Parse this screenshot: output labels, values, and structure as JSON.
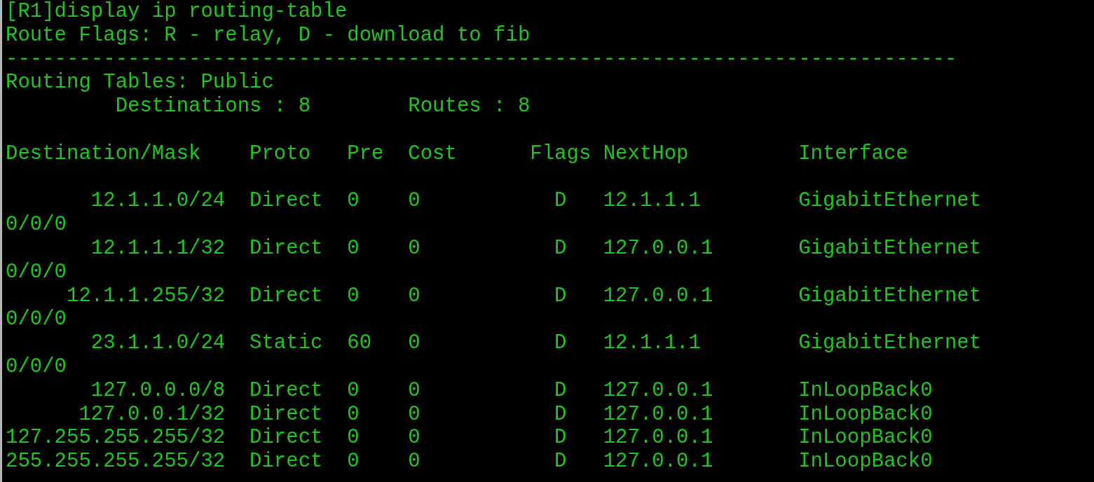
{
  "command": "[R1]display ip routing-table",
  "flags_legend": "Route Flags: R - relay, D - download to fib",
  "separator": "------------------------------------------------------------------------------",
  "table_title": "Routing Tables: Public",
  "summary": {
    "destinations": "Destinations : 8",
    "routes": "Routes : 8"
  },
  "columns": [
    "Destination/Mask",
    "Proto",
    "Pre",
    "Cost",
    "Flags",
    "NextHop",
    "Interface"
  ],
  "rows": [
    {
      "destination": "12.1.1.0/24",
      "proto": "Direct",
      "pre": "0",
      "cost": "0",
      "flags": "D",
      "nexthop": "12.1.1.1",
      "interface": "GigabitEthernet",
      "interface_continued": "0/0/0"
    },
    {
      "destination": "12.1.1.1/32",
      "proto": "Direct",
      "pre": "0",
      "cost": "0",
      "flags": "D",
      "nexthop": "127.0.0.1",
      "interface": "GigabitEthernet",
      "interface_continued": "0/0/0"
    },
    {
      "destination": "12.1.1.255/32",
      "proto": "Direct",
      "pre": "0",
      "cost": "0",
      "flags": "D",
      "nexthop": "127.0.0.1",
      "interface": "GigabitEthernet",
      "interface_continued": "0/0/0"
    },
    {
      "destination": "23.1.1.0/24",
      "proto": "Static",
      "pre": "60",
      "cost": "0",
      "flags": "D",
      "nexthop": "12.1.1.1",
      "interface": "GigabitEthernet",
      "interface_continued": "0/0/0"
    },
    {
      "destination": "127.0.0.0/8",
      "proto": "Direct",
      "pre": "0",
      "cost": "0",
      "flags": "D",
      "nexthop": "127.0.0.1",
      "interface": "InLoopBack0"
    },
    {
      "destination": "127.0.0.1/32",
      "proto": "Direct",
      "pre": "0",
      "cost": "0",
      "flags": "D",
      "nexthop": "127.0.0.1",
      "interface": "InLoopBack0"
    },
    {
      "destination": "127.255.255.255/32",
      "proto": "Direct",
      "pre": "0",
      "cost": "0",
      "flags": "D",
      "nexthop": "127.0.0.1",
      "interface": "InLoopBack0"
    },
    {
      "destination": "255.255.255.255/32",
      "proto": "Direct",
      "pre": "0",
      "cost": "0",
      "flags": "D",
      "nexthop": "127.0.0.1",
      "interface": "InLoopBack0"
    }
  ]
}
